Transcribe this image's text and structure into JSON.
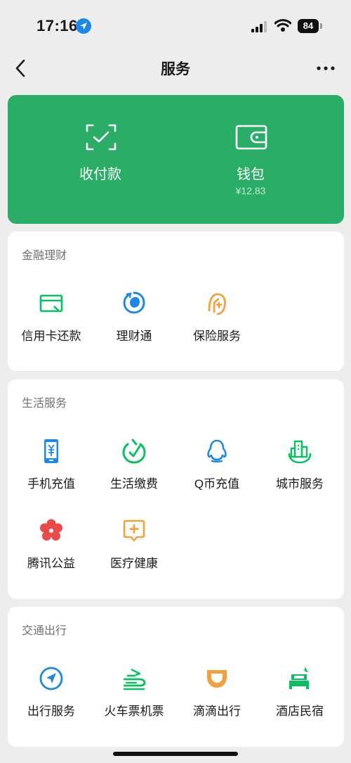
{
  "status_bar": {
    "time": "17:16",
    "battery": "84"
  },
  "nav": {
    "title": "服务"
  },
  "colors": {
    "brand_green": "#2aae67",
    "icon_green": "#07c160",
    "icon_blue": "#1e88e5",
    "icon_orange": "#f5a040",
    "icon_red": "#e94b4b"
  },
  "hero": {
    "pay": {
      "label": "收付款",
      "icon": "scan-frame-icon"
    },
    "wallet": {
      "label": "钱包",
      "balance": "¥12.83",
      "icon": "wallet-icon"
    }
  },
  "sections": [
    {
      "title": "金融理财",
      "items": [
        {
          "label": "信用卡还款",
          "icon": "credit-card-icon"
        },
        {
          "label": "理财通",
          "icon": "wealth-icon"
        },
        {
          "label": "保险服务",
          "icon": "insurance-icon"
        }
      ]
    },
    {
      "title": "生活服务",
      "items": [
        {
          "label": "手机充值",
          "icon": "phone-topup-icon"
        },
        {
          "label": "生活缴费",
          "icon": "bill-pay-icon"
        },
        {
          "label": "Q币充值",
          "icon": "qq-coin-icon"
        },
        {
          "label": "城市服务",
          "icon": "city-service-icon"
        },
        {
          "label": "腾讯公益",
          "icon": "charity-icon"
        },
        {
          "label": "医疗健康",
          "icon": "medical-icon"
        }
      ]
    },
    {
      "title": "交通出行",
      "items": [
        {
          "label": "出行服务",
          "icon": "navigation-icon"
        },
        {
          "label": "火车票机票",
          "icon": "train-ticket-icon"
        },
        {
          "label": "滴滴出行",
          "icon": "didi-icon"
        },
        {
          "label": "酒店民宿",
          "icon": "hotel-icon"
        }
      ]
    }
  ]
}
